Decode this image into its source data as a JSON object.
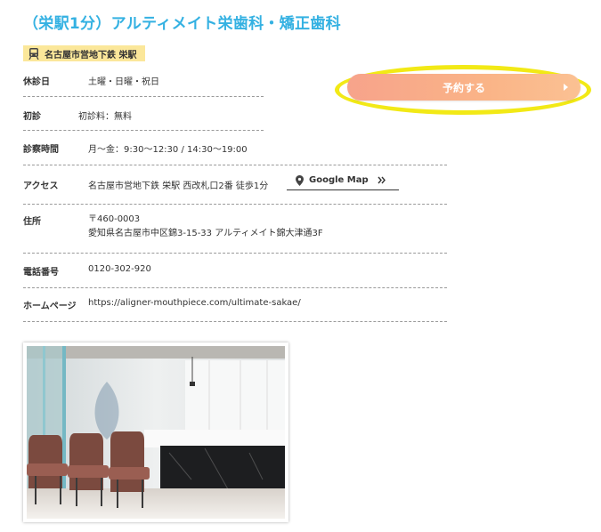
{
  "clinic": {
    "title": "（栄駅1分）アルティメイト栄歯科・矯正歯科",
    "station": "名古屋市営地下鉄 栄駅"
  },
  "info": {
    "closed": {
      "label": "休診日",
      "value": "土曜・日曜・祝日"
    },
    "first_visit": {
      "label": "初診",
      "value": "初診料：無料"
    },
    "hours": {
      "label": "診察時間",
      "value": "月～金：9:30～12:30 / 14:30～19:00"
    },
    "access": {
      "label": "アクセス",
      "value": "名古屋市営地下鉄 栄駅 西改札口2番 徒歩1分",
      "map_label": "Google Map"
    },
    "address": {
      "label": "住所",
      "postal": "〒460-0003",
      "line": "愛知県名古屋市中区錦3-15-33 アルティメイト錦大津通3F"
    },
    "phone": {
      "label": "電話番号",
      "value": "0120-302-920"
    },
    "homepage": {
      "label": "ホームページ",
      "url": "https://aligner-mouthpiece.com/ultimate-sakae/"
    }
  },
  "reserve": {
    "label": "予約する"
  },
  "icons": {
    "station": "train-icon",
    "map": "map-pin-icon",
    "map_arrow": "double-chevron-right-icon",
    "reserve_arrow": "triangle-right-icon"
  },
  "colors": {
    "title": "#34b1e2",
    "station_badge": "#fbe79a",
    "button_start": "#f7a38b",
    "button_end": "#fbc193",
    "highlight": "#f2e916",
    "link": "#1a3e9c"
  }
}
